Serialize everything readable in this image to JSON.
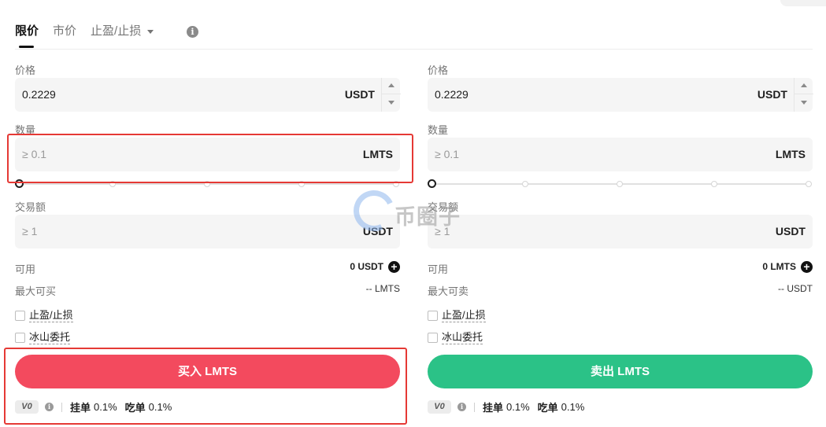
{
  "tabs": [
    {
      "label": "限价",
      "active": true
    },
    {
      "label": "市价",
      "active": false
    },
    {
      "label": "止盈/止损",
      "active": false
    }
  ],
  "buy": {
    "price_label": "价格",
    "price_value": "0.2229",
    "price_unit": "USDT",
    "qty_label": "数量",
    "qty_placeholder": "≥ 0.1",
    "qty_unit": "LMTS",
    "slider_percent": 0,
    "amount_label": "交易额",
    "amount_placeholder": "≥ 1",
    "amount_unit": "USDT",
    "available_label": "可用",
    "available_value": "0 USDT",
    "max_label": "最大可买",
    "max_value": "-- LMTS",
    "tpsl_label": "止盈/止损",
    "iceberg_label": "冰山委托",
    "action_label": "买入 LMTS",
    "vip_label": "V0",
    "maker_label": "挂单",
    "maker_value": "0.1%",
    "taker_label": "吃单",
    "taker_value": "0.1%"
  },
  "sell": {
    "price_label": "价格",
    "price_value": "0.2229",
    "price_unit": "USDT",
    "qty_label": "数量",
    "qty_placeholder": "≥ 0.1",
    "qty_unit": "LMTS",
    "slider_percent": 0,
    "amount_label": "交易额",
    "amount_placeholder": "≥ 1",
    "amount_unit": "USDT",
    "available_label": "可用",
    "available_value": "0 LMTS",
    "max_label": "最大可卖",
    "max_value": "-- USDT",
    "tpsl_label": "止盈/止损",
    "iceberg_label": "冰山委托",
    "action_label": "卖出 LMTS",
    "vip_label": "V0",
    "maker_label": "挂单",
    "maker_value": "0.1%",
    "taker_label": "吃单",
    "taker_value": "0.1%"
  },
  "watermark_text": "币圈子",
  "colors": {
    "buy": "#f34a5e",
    "sell": "#2bc287",
    "highlight": "#e53935"
  },
  "icons": [
    "info-icon",
    "chevron-down-icon",
    "plus-circle-icon",
    "checkbox-icon"
  ]
}
